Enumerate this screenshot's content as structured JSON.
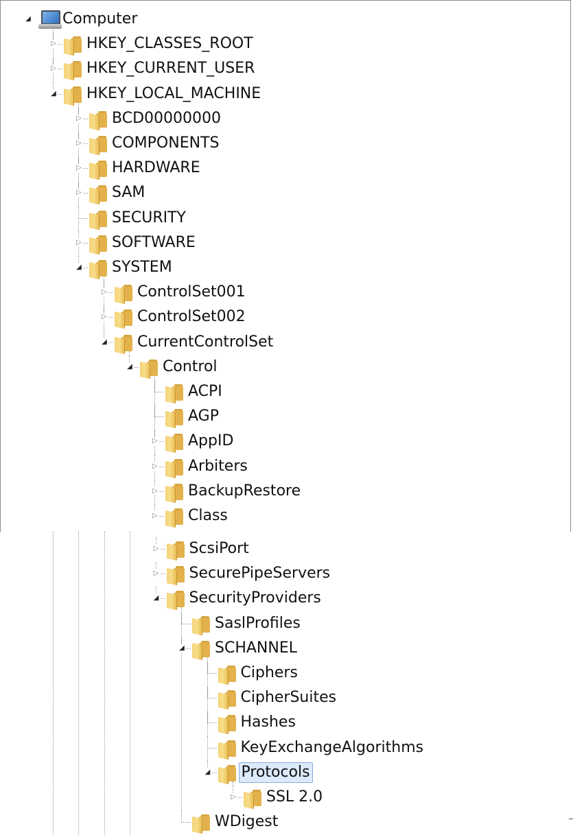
{
  "tree_top": [
    {
      "label": "Computer",
      "icon": "computer-icon",
      "toggle": "expanded",
      "level": 0
    },
    {
      "label": "HKEY_CLASSES_ROOT",
      "icon": "folder-icon",
      "toggle": "collapsed",
      "level": 1
    },
    {
      "label": "HKEY_CURRENT_USER",
      "icon": "folder-icon",
      "toggle": "collapsed",
      "level": 1
    },
    {
      "label": "HKEY_LOCAL_MACHINE",
      "icon": "folder-icon",
      "toggle": "expanded",
      "level": 1
    },
    {
      "label": "BCD00000000",
      "icon": "folder-icon",
      "toggle": "collapsed",
      "level": 2
    },
    {
      "label": "COMPONENTS",
      "icon": "folder-icon",
      "toggle": "collapsed",
      "level": 2
    },
    {
      "label": "HARDWARE",
      "icon": "folder-icon",
      "toggle": "collapsed",
      "level": 2
    },
    {
      "label": "SAM",
      "icon": "folder-icon",
      "toggle": "collapsed",
      "level": 2
    },
    {
      "label": "SECURITY",
      "icon": "folder-icon",
      "toggle": "none",
      "level": 2
    },
    {
      "label": "SOFTWARE",
      "icon": "folder-icon",
      "toggle": "collapsed",
      "level": 2
    },
    {
      "label": "SYSTEM",
      "icon": "folder-icon",
      "toggle": "expanded",
      "level": 2
    },
    {
      "label": "ControlSet001",
      "icon": "folder-icon",
      "toggle": "collapsed",
      "level": 3
    },
    {
      "label": "ControlSet002",
      "icon": "folder-icon",
      "toggle": "collapsed",
      "level": 3
    },
    {
      "label": "CurrentControlSet",
      "icon": "folder-icon",
      "toggle": "expanded",
      "level": 3
    },
    {
      "label": "Control",
      "icon": "folder-icon",
      "toggle": "expanded",
      "level": 4
    },
    {
      "label": "ACPI",
      "icon": "folder-icon",
      "toggle": "none",
      "level": 5
    },
    {
      "label": "AGP",
      "icon": "folder-icon",
      "toggle": "none",
      "level": 5
    },
    {
      "label": "AppID",
      "icon": "folder-icon",
      "toggle": "collapsed",
      "level": 5
    },
    {
      "label": "Arbiters",
      "icon": "folder-icon",
      "toggle": "collapsed",
      "level": 5
    },
    {
      "label": "BackupRestore",
      "icon": "folder-icon",
      "toggle": "collapsed",
      "level": 5
    },
    {
      "label": "Class",
      "icon": "folder-icon",
      "toggle": "collapsed",
      "level": 5
    }
  ],
  "tree_bottom": [
    {
      "label": "ScsiPort",
      "icon": "folder-icon",
      "toggle": "collapsed",
      "level": 5
    },
    {
      "label": "SecurePipeServers",
      "icon": "folder-icon",
      "toggle": "collapsed",
      "level": 5
    },
    {
      "label": "SecurityProviders",
      "icon": "folder-icon",
      "toggle": "expanded",
      "level": 5
    },
    {
      "label": "SaslProfiles",
      "icon": "folder-icon",
      "toggle": "none",
      "level": 6
    },
    {
      "label": "SCHANNEL",
      "icon": "folder-icon",
      "toggle": "expanded",
      "level": 6
    },
    {
      "label": "Ciphers",
      "icon": "folder-icon",
      "toggle": "none",
      "level": 7
    },
    {
      "label": "CipherSuites",
      "icon": "folder-icon",
      "toggle": "none",
      "level": 7
    },
    {
      "label": "Hashes",
      "icon": "folder-icon",
      "toggle": "none",
      "level": 7
    },
    {
      "label": "KeyExchangeAlgorithms",
      "icon": "folder-icon",
      "toggle": "none",
      "level": 7
    },
    {
      "label": "Protocols",
      "icon": "folder-icon",
      "toggle": "expanded",
      "level": 7,
      "selected": true
    },
    {
      "label": "SSL 2.0",
      "icon": "folder-icon",
      "toggle": "collapsed",
      "level": 8
    },
    {
      "label": "WDigest",
      "icon": "folder-icon",
      "toggle": "none",
      "level": 6
    }
  ],
  "glyphs": {
    "collapsed": "▷",
    "expanded": "◢"
  },
  "colors": {
    "selection_bg": "#dceafc",
    "selection_border": "#84acdd",
    "folder": "#f4d379"
  }
}
